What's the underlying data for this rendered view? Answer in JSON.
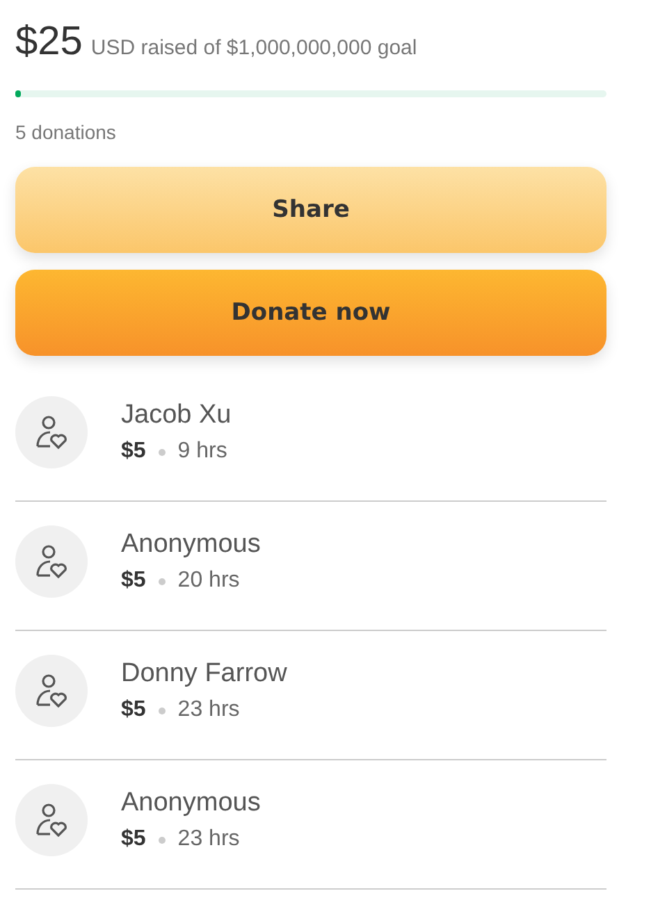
{
  "raised": {
    "amount": "$25",
    "text": "USD raised of $1,000,000,000 goal",
    "level": 0.005
  },
  "donation_count": "5 donations",
  "buttons": [
    {
      "label": "Share",
      "kind": "secondary"
    },
    {
      "label": "Donate now",
      "kind": "primary"
    }
  ],
  "donations": [
    {
      "name": "Jacob Xu",
      "amount": "$5",
      "time": "9 hrs"
    },
    {
      "name": "Anonymous",
      "amount": "$5",
      "time": "20 hrs"
    },
    {
      "name": "Donny Farrow",
      "amount": "$5",
      "time": "23 hrs"
    },
    {
      "name": "Anonymous",
      "amount": "$5",
      "time": "23 hrs"
    }
  ]
}
